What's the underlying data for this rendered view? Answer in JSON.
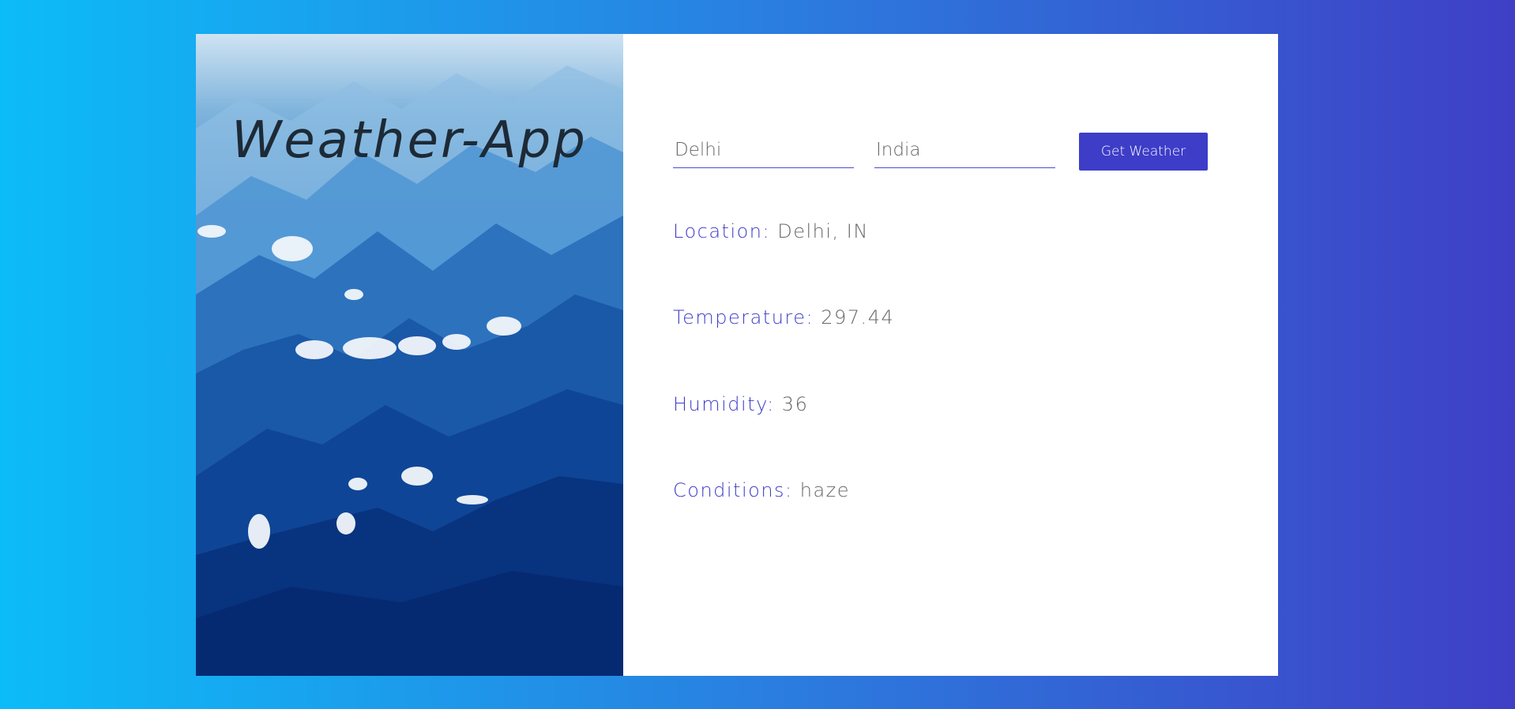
{
  "app": {
    "title": "Weather-App"
  },
  "form": {
    "city_value": "Delhi",
    "country_value": "India",
    "submit_label": "Get Weather"
  },
  "results": {
    "location_label": "Location:",
    "location_value": "Delhi, IN",
    "temperature_label": "Temperature:",
    "temperature_value": "297.44",
    "humidity_label": "Humidity:",
    "humidity_value": "36",
    "conditions_label": "Conditions:",
    "conditions_value": "haze"
  },
  "colors": {
    "accent": "#3d3dc8",
    "bg_start": "#0cbcf8",
    "bg_end": "#3f3fc6",
    "value_text": "#666666"
  }
}
